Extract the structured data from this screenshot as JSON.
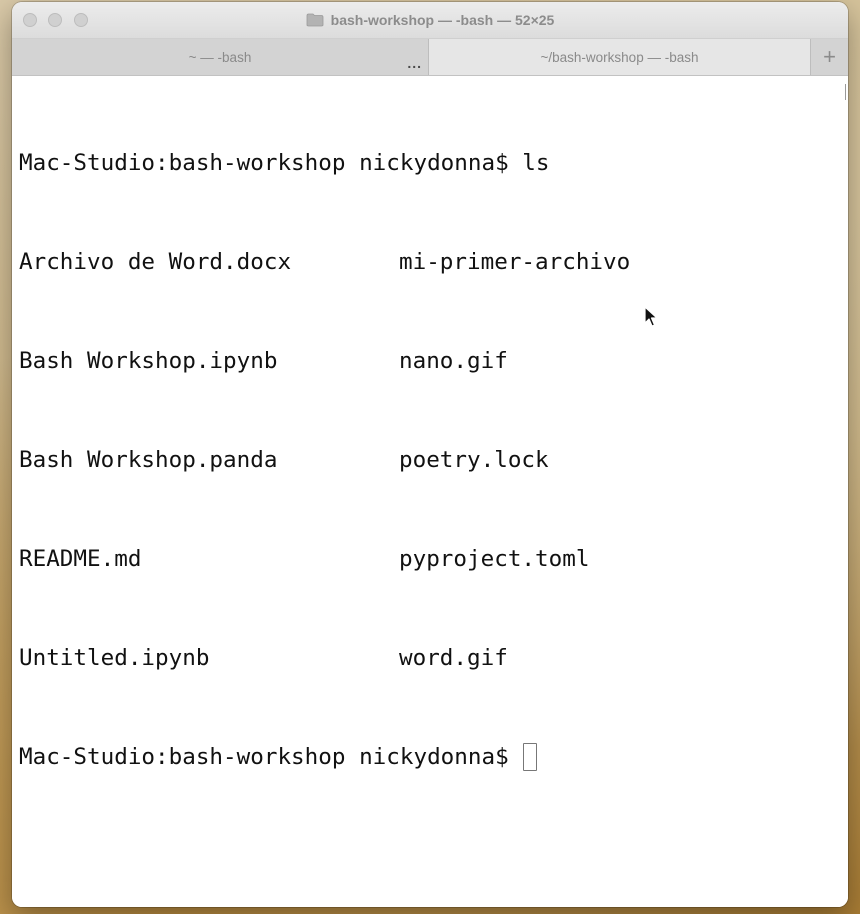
{
  "window": {
    "title": "bash-workshop — -bash — 52×25"
  },
  "tabs": [
    {
      "label": "~ — -bash",
      "overflow": "...",
      "active": false
    },
    {
      "label": "~/bash-workshop — -bash",
      "active": true
    }
  ],
  "new_tab_label": "+",
  "terminal": {
    "command_line": "Mac-Studio:bash-workshop nickydonna$ ls",
    "listing": [
      [
        "Archivo de Word.docx",
        "mi-primer-archivo"
      ],
      [
        "Bash Workshop.ipynb",
        "nano.gif"
      ],
      [
        "Bash Workshop.panda",
        "poetry.lock"
      ],
      [
        "README.md",
        "pyproject.toml"
      ],
      [
        "Untitled.ipynb",
        "word.gif"
      ]
    ],
    "prompt": "Mac-Studio:bash-workshop nickydonna$"
  },
  "icons": {
    "title_icon": "folder-icon",
    "cursor": "mouse-pointer-icon"
  }
}
